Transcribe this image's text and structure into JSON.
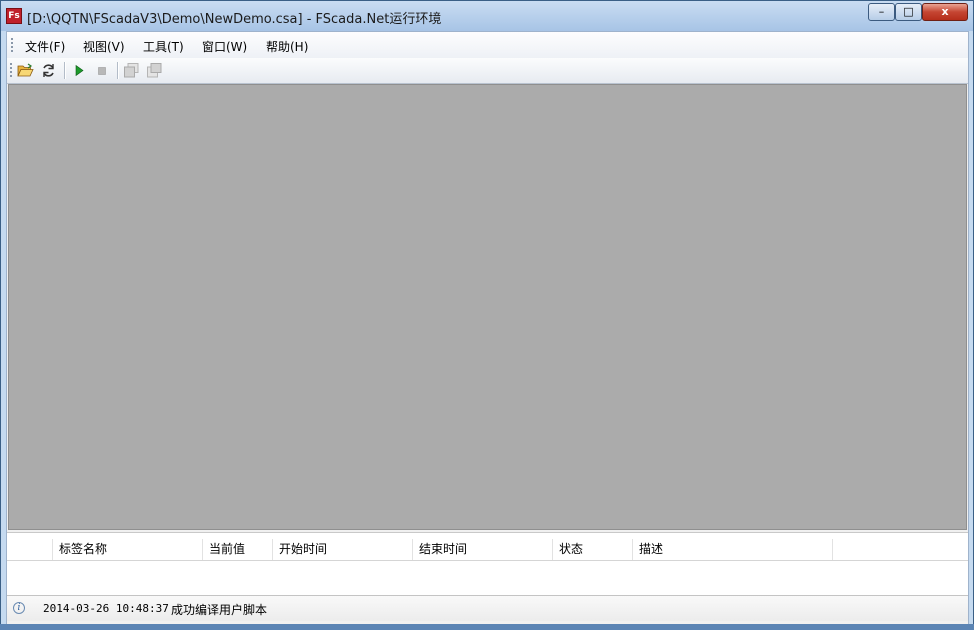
{
  "window": {
    "title": "[D:\\QQTN\\FScadaV3\\Demo\\NewDemo.csa] - FScada.Net运行环境",
    "controls": {
      "minimize": "–",
      "maximize": "□",
      "close": "x"
    }
  },
  "menu": {
    "items": [
      {
        "label": "文件(F)"
      },
      {
        "label": "视图(V)"
      },
      {
        "label": "工具(T)"
      },
      {
        "label": "窗口(W)"
      },
      {
        "label": "帮助(H)"
      }
    ]
  },
  "toolbar": {
    "buttons": [
      {
        "icon": "open-folder-icon"
      },
      {
        "icon": "refresh-icon"
      },
      {
        "icon": "play-icon"
      },
      {
        "icon": "stop-icon"
      },
      {
        "icon": "window-back-icon"
      },
      {
        "icon": "window-forward-icon"
      }
    ]
  },
  "alarm_table": {
    "columns": [
      "",
      "标签名称",
      "当前值",
      "开始时间",
      "结束时间",
      "状态",
      "描述",
      ""
    ]
  },
  "status": {
    "time": "2014-03-26 10:48:37",
    "message": "成功编译用户脚本"
  },
  "colors": {
    "workspace": "#ababab",
    "titlebar": "#b9d1ea",
    "close_button": "#c54532"
  }
}
